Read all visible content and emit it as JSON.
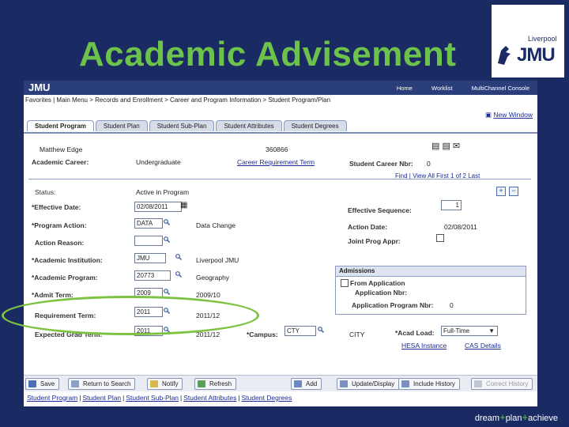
{
  "slide": {
    "title": "Academic Advisement",
    "logo_small": "Liverpool",
    "logo_big": "JMU",
    "slogan_parts": [
      "dream",
      "+",
      "plan",
      "+",
      "achieve"
    ]
  },
  "app": {
    "logo": "JMU",
    "top_links": [
      "Home",
      "Worklist",
      "MultiChannel Console"
    ],
    "breadcrumb": "Favorites | Main Menu > Records and Enrollment > Career and Program Information > Student Program/Plan",
    "new_window": "New Window",
    "tabs": [
      "Student Program",
      "Student Plan",
      "Student Sub-Plan",
      "Student Attributes",
      "Student Degrees"
    ],
    "student_name": "Matthew Edge",
    "student_id": "360866",
    "academic_career_label": "Academic Career:",
    "academic_career_value": "Undergraduate",
    "career_req_term_link": "Career Requirement Term",
    "student_career_nbr_label": "Student Career Nbr:",
    "student_career_nbr_value": "0",
    "nav": "Find | View All   First  1 of 2  Last",
    "status_label": "Status:",
    "status_value": "Active in Program",
    "effective_date_label": "*Effective Date:",
    "effective_date_value": "02/08/2011",
    "effective_seq_label": "Effective Sequence:",
    "effective_seq_value": "1",
    "program_action_label": "*Program Action:",
    "program_action_value": "DATA",
    "program_action_desc": "Data Change",
    "action_date_label": "Action Date:",
    "action_date_value": "02/08/2011",
    "action_reason_label": "Action Reason:",
    "joint_prog_label": "Joint Prog Appr:",
    "institution_label": "*Academic Institution:",
    "institution_value": "JMU",
    "institution_desc": "Liverpool JMU",
    "program_label": "*Academic Program:",
    "program_value": "20773",
    "program_desc": "Geography",
    "admissions_header": "Admissions",
    "from_application": "From Application",
    "application_nbr_label": "Application Nbr:",
    "application_prog_nbr_label": "Application Program Nbr:",
    "application_prog_nbr_value": "0",
    "admit_term_label": "*Admit Term:",
    "admit_term_value": "2009",
    "admit_term_desc": "2009/10",
    "req_term_label": "Requirement Term:",
    "req_term_value": "2011",
    "req_term_desc": "2011/12",
    "grad_term_label": "Expected Grad Term:",
    "grad_term_value": "2011",
    "grad_term_desc": "2011/12",
    "campus_label": "*Campus:",
    "campus_value": "CTY",
    "campus_desc": "CITY",
    "acad_load_label": "*Acad Load:",
    "acad_load_value": "Full-Time",
    "hesa_link": "HESA Instance",
    "cas_link": "CAS Details",
    "buttons": [
      "Save",
      "Return to Search",
      "Notify",
      "Refresh",
      "Add",
      "Update/Display",
      "Include History",
      "Correct History"
    ],
    "bottom_links": [
      "Student Program",
      "Student Plan",
      "Student Sub-Plan",
      "Student Attributes",
      "Student Degrees"
    ]
  },
  "colors": {
    "slide_bg": "#1a2b63",
    "title_green": "#6cc24a",
    "link_blue": "#1a2b94"
  }
}
